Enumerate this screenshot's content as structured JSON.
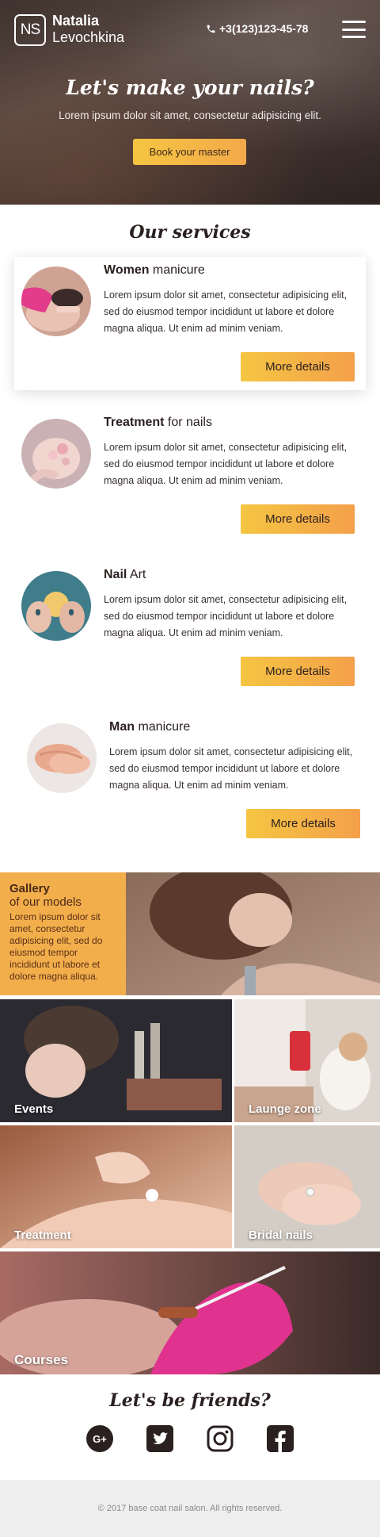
{
  "header": {
    "logo": "NS",
    "first_name": "Natalia",
    "last_name": "Levochkina",
    "phone": "+3(123)123-45-78",
    "menu_icon": "hamburger-icon"
  },
  "hero": {
    "title": "Let's make your nails?",
    "subtitle": "Lorem ipsum dolor sit amet, consectetur adipisicing elit.",
    "button": "Book your master"
  },
  "services": {
    "title": "Our services",
    "items": [
      {
        "bold": "Women",
        "rest": " manicure",
        "text": "Lorem ipsum dolor sit amet, consectetur adipisicing elit, sed do eiusmod tempor incididunt ut labore et dolore magna aliqua. Ut enim ad minim veniam.",
        "button": "More details"
      },
      {
        "bold": "Treatment",
        "rest": " for nails",
        "text": "Lorem ipsum dolor sit amet, consectetur adipisicing elit, sed do eiusmod tempor incididunt ut labore et dolore magna aliqua. Ut enim ad minim veniam.",
        "button": "More details"
      },
      {
        "bold": "Nail",
        "rest": " Art",
        "text": "Lorem ipsum dolor sit amet, consectetur adipisicing elit, sed do eiusmod tempor incididunt ut labore et dolore magna aliqua. Ut enim ad minim veniam.",
        "button": "More details"
      },
      {
        "bold": "Man",
        "rest": " manicure",
        "text": "Lorem ipsum dolor sit amet, consectetur adipisicing elit, sed do eiusmod tempor incididunt ut labore et dolore magna aliqua. Ut enim ad minim veniam.",
        "button": "More details"
      }
    ]
  },
  "gallery": {
    "title": "Gallery",
    "subtitle": "of our models",
    "text": "Lorem ipsum dolor sit amet, consectetur adipisicing elit, sed do eiusmod tempor incididunt ut labore et dolore magna aliqua.",
    "tiles": [
      "Events",
      "Launge zone",
      "Treatment",
      "Bridal nails",
      "Courses"
    ]
  },
  "friends": {
    "title": "Let's be friends?",
    "icons": [
      "google-plus-icon",
      "twitter-icon",
      "instagram-icon",
      "facebook-icon"
    ]
  },
  "footer": {
    "copyright": "© 2017 base coat nail salon. All rights reserved."
  },
  "colors": {
    "accent_start": "#f5c542",
    "accent_end": "#f4a04a",
    "gallery_bg": "#f3ae4c",
    "footer_bg": "#eeeeee"
  }
}
